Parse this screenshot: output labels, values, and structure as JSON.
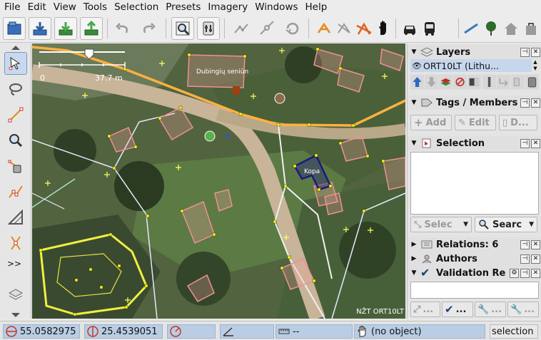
{
  "menus": [
    "File",
    "Edit",
    "View",
    "Tools",
    "Selection",
    "Presets",
    "Imagery",
    "Windows",
    "Help"
  ],
  "toolbar_icons": [
    "open-file-icon",
    "download-icon",
    "download-data-icon",
    "upload-icon",
    "undo-icon",
    "redo-icon",
    "preferences-icon",
    "combine-way-icon",
    "split-way-icon",
    "reverse-way-icon",
    "align-circle-icon",
    "orthogonalize-icon",
    "simplify-icon",
    "pan-hand-icon",
    "car-icon",
    "bus-icon",
    "line-preset-icon",
    "tree-icon",
    "house-icon",
    "shop-icon"
  ],
  "left_tools": [
    "select-tool-icon",
    "lasso-tool-icon",
    "draw-tool-icon",
    "zoom-tool-icon",
    "delete-tool-icon",
    "improve-way-icon",
    "parallel-way-icon",
    "split-tool-icon"
  ],
  "left_more": ">>",
  "map": {
    "scale_start": "0",
    "scale_end": "37.7 m",
    "imagery_credit": "NŽT ORT10LT",
    "labels": [
      "Dubingių seniūn",
      "Kopa"
    ]
  },
  "panels": {
    "layers": {
      "title": "Layers",
      "layer_name": "ORT10LT (Lithu..."
    },
    "tags": {
      "title": "Tags / Members",
      "add": "Add",
      "edit": "Edit",
      "delete": "D..."
    },
    "selection": {
      "title": "Selection",
      "select_btn": "Selec",
      "search_btn": "Searc"
    },
    "relations": {
      "title": "Relations: 6"
    },
    "authors": {
      "title": "Authors"
    },
    "validation": {
      "title": "Validation Re",
      "btn_more": "..."
    }
  },
  "status": {
    "lat": "55.0582975",
    "lon": "25.4539051",
    "heading": "",
    "angle": "",
    "distance": "--",
    "object": "(no object)",
    "mode": "selection"
  },
  "colors": {
    "building_outline": "#f09090",
    "road": "#ffb040",
    "landuse_outline": "#f0f040",
    "selected": "#1a1a80"
  }
}
